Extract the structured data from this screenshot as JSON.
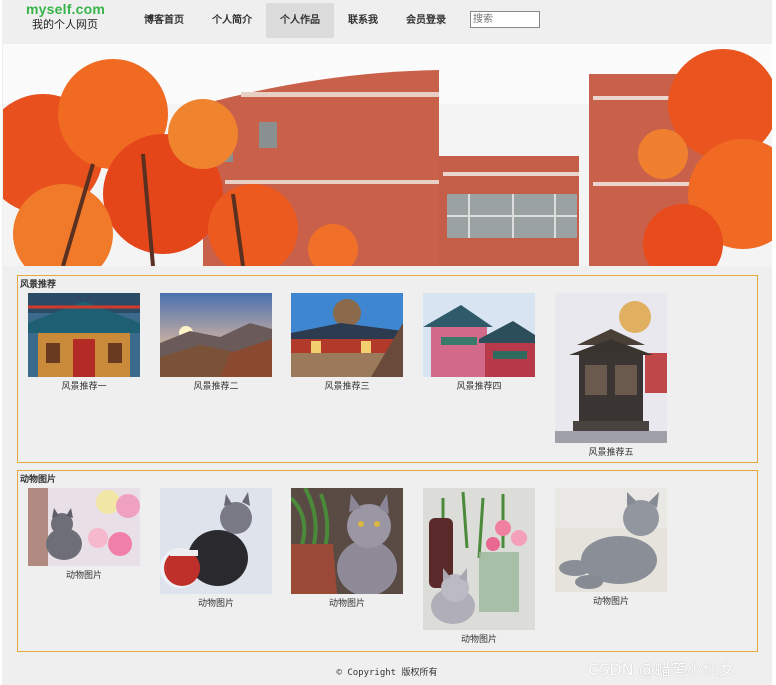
{
  "header": {
    "logo": "myself.com",
    "subtitle": "我的个人网页",
    "nav": [
      {
        "label": "博客首页"
      },
      {
        "label": "个人简介"
      },
      {
        "label": "个人作品"
      },
      {
        "label": "联系我"
      },
      {
        "label": "会员登录"
      }
    ],
    "active_nav": "个人作品",
    "search_placeholder": "搜索"
  },
  "sections": {
    "scenery": {
      "title": "风景推荐",
      "items": [
        {
          "caption": "风景推荐一"
        },
        {
          "caption": "风景推荐二"
        },
        {
          "caption": "风景推荐三"
        },
        {
          "caption": "风景推荐四"
        },
        {
          "caption": "风景推荐五"
        }
      ]
    },
    "animals": {
      "title": "动物图片",
      "items": [
        {
          "caption": "动物图片"
        },
        {
          "caption": "动物图片"
        },
        {
          "caption": "动物图片"
        },
        {
          "caption": "动物图片"
        },
        {
          "caption": "动物图片"
        }
      ]
    }
  },
  "footer": "© Copyright 版权所有",
  "watermark": "CSDN @蜡笔小仙女",
  "colors": {
    "logo": "#37b44a",
    "section_border": "#e5a83c",
    "background": "#efefef"
  }
}
